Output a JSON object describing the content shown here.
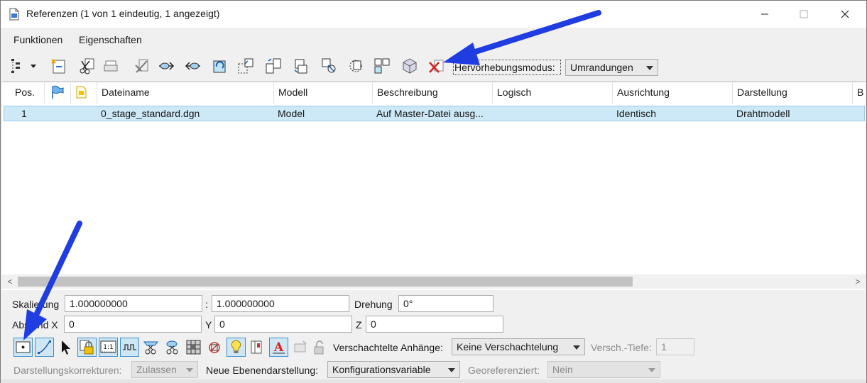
{
  "window": {
    "title": "Referenzen (1 von 1 eindeutig, 1 angezeigt)"
  },
  "menu": {
    "funktionen": "Funktionen",
    "eigenschaften": "Eigenschaften"
  },
  "toolbar": {
    "highlight_label": "Hervorhebungsmodus:",
    "highlight_value": "Umrandungen"
  },
  "table": {
    "columns": [
      "Pos.",
      "",
      "",
      "Dateiname",
      "Modell",
      "Beschreibung",
      "Logisch",
      "Ausrichtung",
      "Darstellung",
      "B"
    ],
    "rows": [
      {
        "pos": "1",
        "dateiname": "0_stage_standard.dgn",
        "modell": "Model",
        "beschreibung": "Auf Master-Datei ausg...",
        "logisch": "",
        "ausrichtung": "Identisch",
        "darstellung": "Drahtmodell"
      }
    ]
  },
  "scrollbar": {
    "left": "<",
    "right": ">"
  },
  "props": {
    "skalierung_label": "Skalierung",
    "skalierung_1": "1.000000000",
    "ratio_sep": ":",
    "skalierung_2": "1.000000000",
    "drehung_label": "Drehung",
    "drehung": "0°",
    "abstand_label": "Abstand X",
    "x": "0",
    "y_label": "Y",
    "y": "0",
    "z_label": "Z",
    "z": "0",
    "nested_label": "Verschachtelte Anhänge:",
    "nested_value": "Keine Verschachtelung",
    "depth_label": "Versch.-Tiefe:",
    "depth_value": "1",
    "corrections_label": "Darstellungskorrekturen:",
    "corrections_value": "Zulassen",
    "new_level_label": "Neue Ebenendarstellung:",
    "new_level_value": "Konfigurationsvariable",
    "georef_label": "Georeferenziert:",
    "georef_value": "Nein"
  },
  "colors": {
    "selection": "#cde8f7",
    "annotation_arrow": "#1f3de0",
    "delete_red": "#d9201c"
  }
}
